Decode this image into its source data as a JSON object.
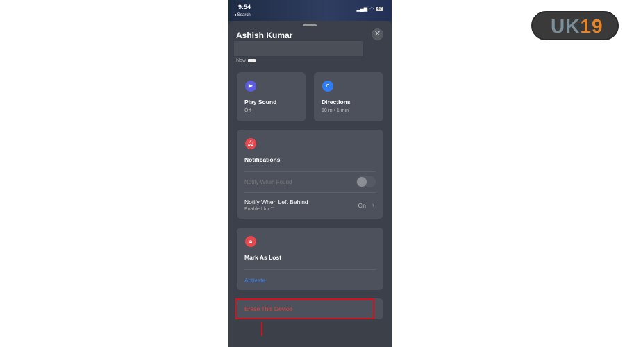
{
  "status": {
    "time": "9:54",
    "back": "◂ Search",
    "battery": "47"
  },
  "sheet": {
    "title": "Ashish Kumar",
    "updated": "Now"
  },
  "play_sound": {
    "title": "Play Sound",
    "subtitle": "Off"
  },
  "directions": {
    "title": "Directions",
    "subtitle": "10 m • 1 min"
  },
  "notifications": {
    "title": "Notifications",
    "found": "Notify When Found",
    "left": "Notify When Left Behind",
    "left_sub": "Enabled for \"\"",
    "left_value": "On",
    "found_enabled": false
  },
  "lost": {
    "title": "Mark As Lost",
    "action": "Activate"
  },
  "erase": {
    "label": "Erase This Device"
  },
  "logo": {
    "text_a": "UK",
    "text_b": "19"
  },
  "colors": {
    "highlight": "#d1141b",
    "link": "#3b82f6",
    "erase": "#e0443d"
  }
}
